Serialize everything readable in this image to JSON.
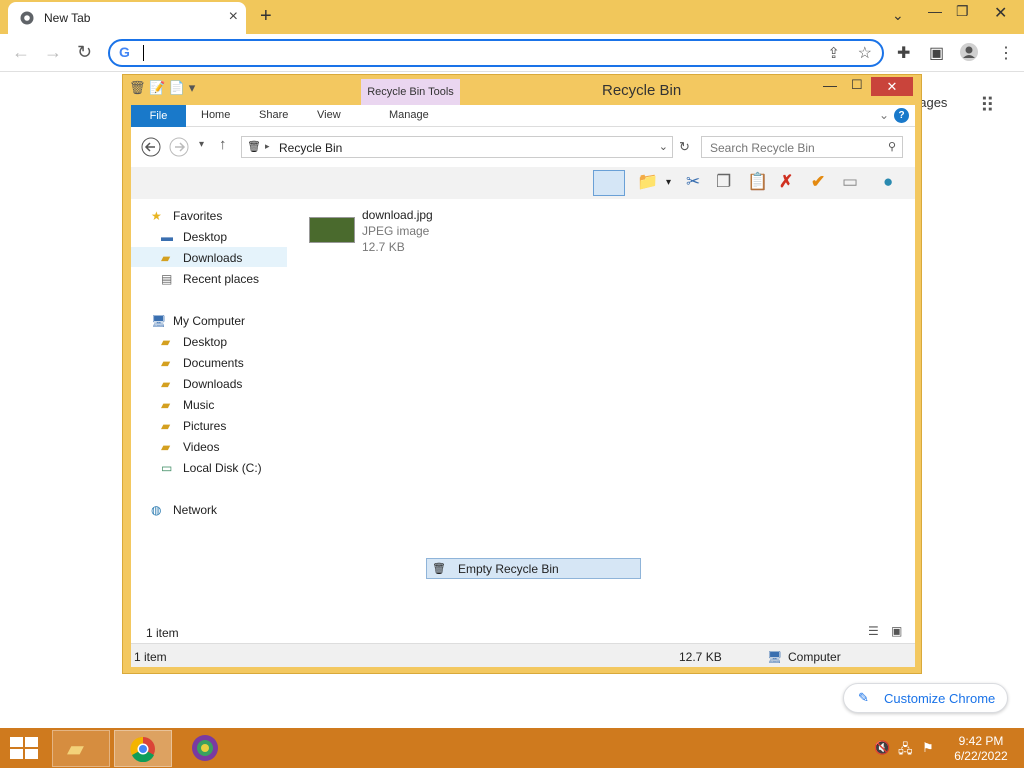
{
  "browser": {
    "tab_title": "New Tab",
    "omnibox_value": "",
    "ntp_images_label": "nages",
    "customize_label": "Customize Chrome"
  },
  "explorer": {
    "window_title": "Recycle Bin",
    "context_tab": "Recycle Bin Tools",
    "ribbon_tabs": {
      "file": "File",
      "home": "Home",
      "share": "Share",
      "view": "View",
      "manage": "Manage"
    },
    "address": "Recycle Bin",
    "search_placeholder": "Search Recycle Bin",
    "nav": {
      "favorites": "Favorites",
      "fav_desktop": "Desktop",
      "fav_downloads": "Downloads",
      "fav_recent": "Recent places",
      "my_computer": "My Computer",
      "pc_desktop": "Desktop",
      "pc_documents": "Documents",
      "pc_downloads": "Downloads",
      "pc_music": "Music",
      "pc_pictures": "Pictures",
      "pc_videos": "Videos",
      "pc_local_disk": "Local Disk (C:)",
      "network": "Network"
    },
    "file": {
      "name": "download.jpg",
      "type": "JPEG image",
      "size": "12.7 KB"
    },
    "context_menu_item": "Empty Recycle Bin",
    "item_count": "1 item",
    "status": {
      "count": "1 item",
      "size": "12.7 KB",
      "location": "Computer"
    }
  },
  "taskbar": {
    "time": "9:42 PM",
    "date": "6/22/2022"
  },
  "colors": {
    "taskbar": "#cf7a1e",
    "titlebar": "#f3c860",
    "accent": "#1979ca"
  }
}
